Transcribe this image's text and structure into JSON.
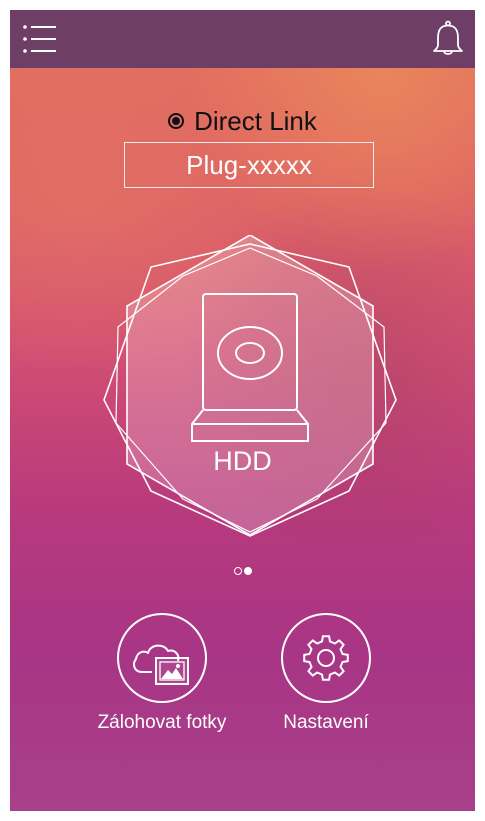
{
  "topbar": {
    "menu_icon": "menu-list-icon",
    "bell_icon": "bell-icon",
    "color": "#6f3e66"
  },
  "connection": {
    "mode_label": "Direct Link",
    "device_name": "Plug-xxxxx"
  },
  "device": {
    "label": "HDD",
    "icon": "hard-drive-icon"
  },
  "pager": {
    "pages": 2,
    "active": 2
  },
  "actions": [
    {
      "label": "Zálohovat fotky",
      "icon": "cloud-photo-backup-icon"
    },
    {
      "label": "Nastavení",
      "icon": "gear-icon"
    }
  ]
}
